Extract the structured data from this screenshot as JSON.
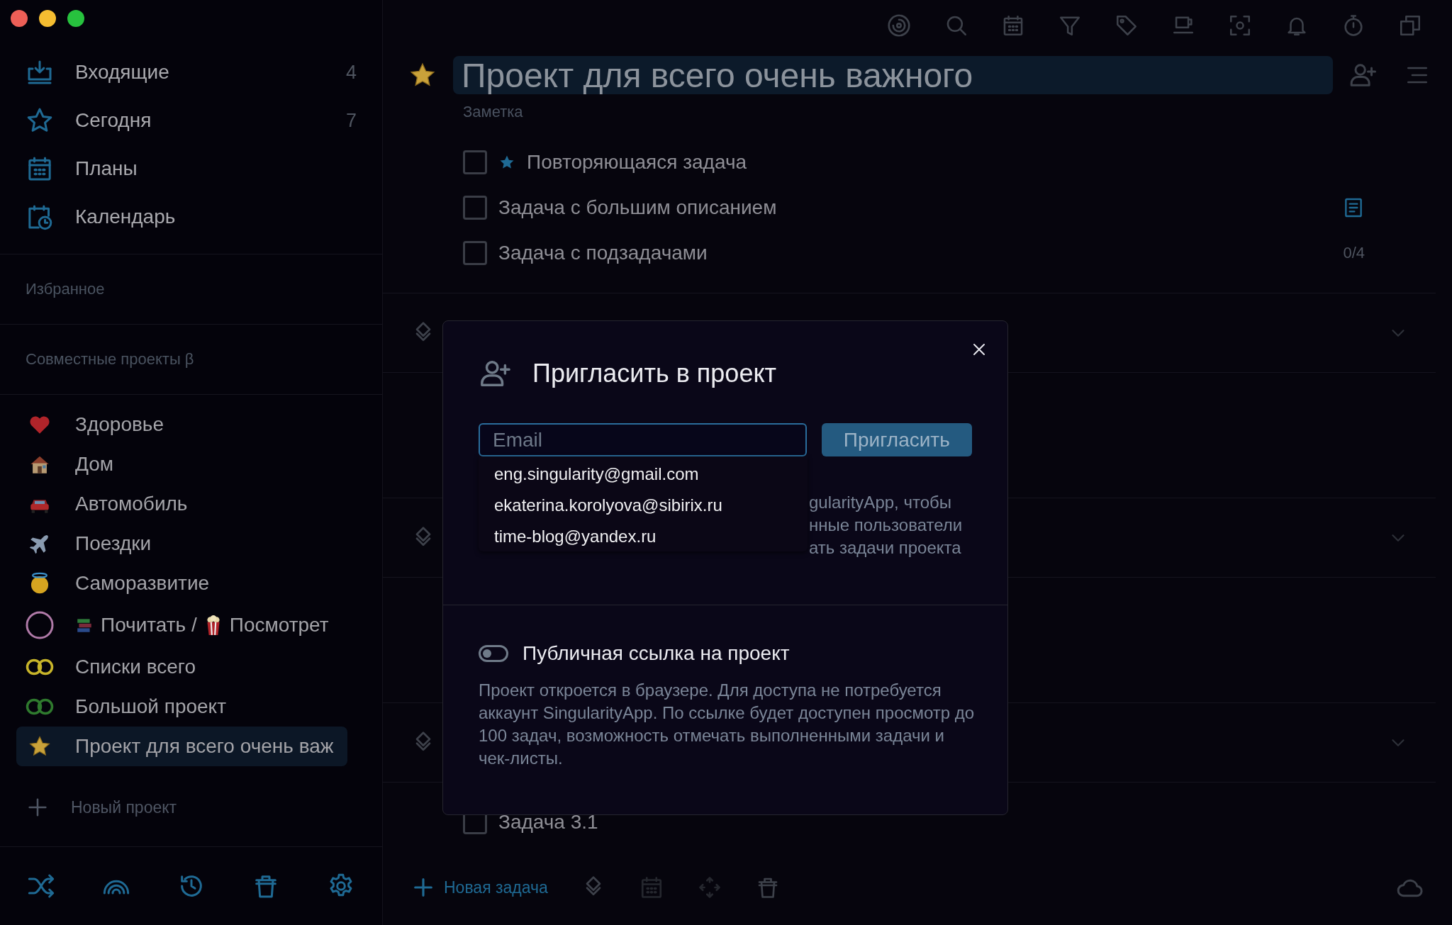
{
  "sidebar": {
    "nav": [
      {
        "label": "Входящие",
        "count": "4"
      },
      {
        "label": "Сегодня",
        "count": "7"
      },
      {
        "label": "Планы"
      },
      {
        "label": "Календарь"
      }
    ],
    "favorites_header": "Избранное",
    "shared_header": "Совместные проекты β",
    "projects": [
      {
        "label": "Здоровье",
        "selected": false
      },
      {
        "label": "Дом",
        "selected": false
      },
      {
        "label": "Автомобиль",
        "selected": false
      },
      {
        "label": "Поездки",
        "selected": false
      },
      {
        "label": "Саморазвитие",
        "selected": false
      },
      {
        "segments": [
          "Почитать /",
          "Посмотрет"
        ],
        "color": "#b07aa8",
        "selected": false
      },
      {
        "label": "Списки всего",
        "color": "#c8b52a",
        "selected": false
      },
      {
        "label": "Большой проект",
        "color": "#2f7a2e",
        "selected": false
      },
      {
        "label": "Проект для всего очень важ",
        "selected": true
      }
    ],
    "new_project": "Новый проект"
  },
  "project": {
    "title": "Проект для всего очень важного",
    "note_placeholder": "Заметка"
  },
  "tasks": [
    {
      "text": "Повторяющаяся задача",
      "checked": false,
      "starred": true
    },
    {
      "text": "Задача с большим описанием",
      "checked": false,
      "starred": false,
      "has_note": true
    },
    {
      "text": "Задача с подзадачами",
      "checked": false,
      "starred": false,
      "progress": "0/4"
    }
  ],
  "sections": [
    {
      "expanded": true
    },
    {
      "expanded": true
    },
    {
      "expanded": true,
      "tasks": [
        {
          "text": "Задача 3.1",
          "checked": false
        }
      ]
    }
  ],
  "bottom_bar": {
    "new_task": "Новая задача"
  },
  "dialog": {
    "title": "Пригласить в проект",
    "email_placeholder": "Email",
    "invite_button": "Пригласить",
    "suggestions": [
      "eng.singularity@gmail.com",
      "ekaterina.korolyova@sibirix.ru",
      "time-blog@yandex.ru"
    ],
    "partly_hidden_text": [
      "gularityApp, чтобы",
      "нные пользователи",
      "ать задачи проекта"
    ],
    "public_link": {
      "label": "Публичная ссылка на проект",
      "on": false,
      "description": "Проект откроется в браузере. Для доступа не потребуется аккаунт SingularityApp. По ссылке будет доступен просмотр до 100 задач, возможность отмечать выполненными задачи и чек-листы."
    }
  }
}
